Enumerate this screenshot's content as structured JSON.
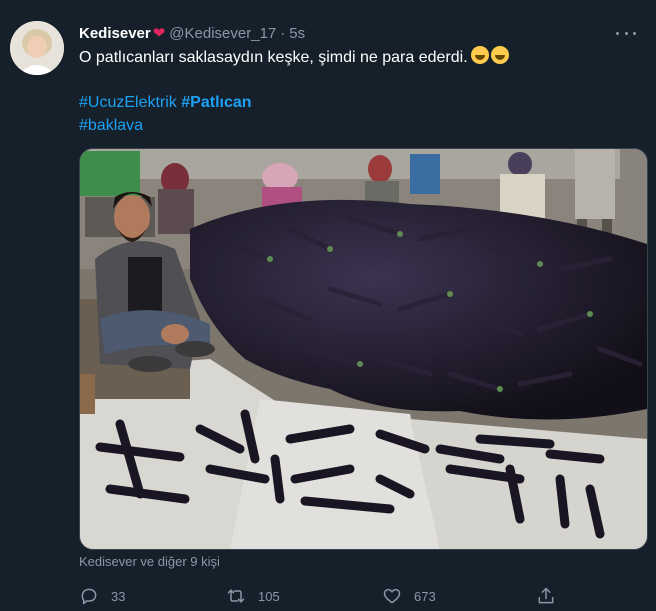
{
  "tweet": {
    "display_name": "Kedisever",
    "heart_icon": "red-heart-icon",
    "handle": "@Kedisever_17",
    "separator": "·",
    "time": "5s",
    "text": "O patlıcanları saklasaydın keşke, şimdi ne para ederdi.",
    "emojis": [
      "rolling-on-floor-laughing-emoji",
      "rolling-on-floor-laughing-emoji"
    ],
    "hashtags": [
      "#UcuzElektrik",
      "#Patlıcan",
      "#baklava"
    ],
    "media_alt": "photo-of-man-with-eggplant-pile",
    "liked_by": "Kedisever ve diğer 9 kişi",
    "reply_count": "33",
    "retweet_count": "105",
    "like_count": "673"
  },
  "colors": {
    "background": "#15202b",
    "text": "#ffffff",
    "secondary": "#8899a6",
    "link": "#1da1f2",
    "heart": "#e0245e"
  }
}
